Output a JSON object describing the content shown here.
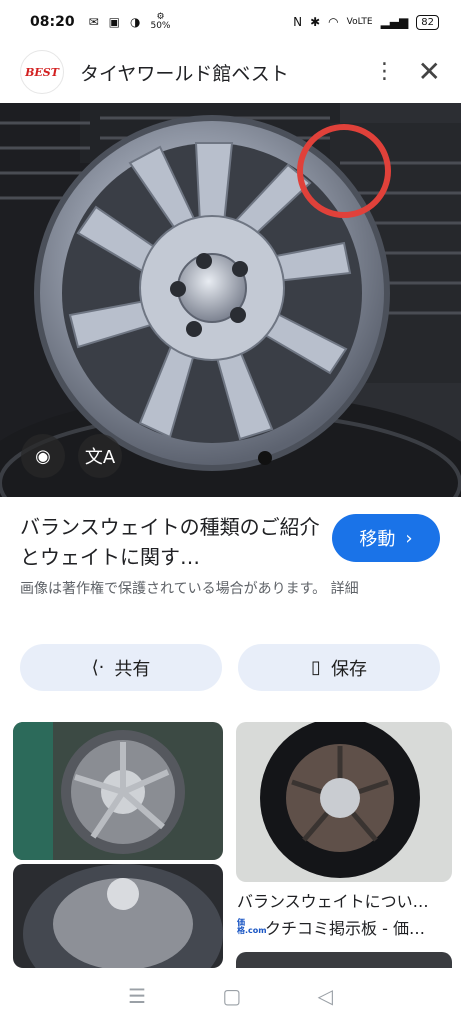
{
  "status_bar": {
    "time": "08:20",
    "left_icons": [
      "mail-icon",
      "sim-icon",
      "data-saver-icon",
      "speed-50-icon"
    ],
    "speed_label": "50%",
    "right_icons": [
      "nfc-icon",
      "bluetooth-icon",
      "wifi-icon",
      "volte-icon",
      "signal-icon"
    ],
    "battery": "82"
  },
  "header": {
    "site_name": "タイヤワールド館ベスト",
    "logo_text": "BEST"
  },
  "hero": {
    "lens_icon": "lens-camera-icon",
    "translate_icon": "translate-icon"
  },
  "result": {
    "title": "バランスウェイトの種類のご紹介とウェイトに関す…",
    "visit_label": "移動",
    "copyright": "画像は著作権で保護されている場合があります。 詳細"
  },
  "actions": {
    "share_label": "共有",
    "save_label": "保存"
  },
  "related": {
    "caption": "バランスウェイトについ…",
    "source_logo": "価格.com",
    "source_name": "クチコミ掲示板 - 価…"
  },
  "colors": {
    "accent": "#1a73e8",
    "action_bg": "#e8eef9",
    "highlight_circle": "#e0413a"
  }
}
